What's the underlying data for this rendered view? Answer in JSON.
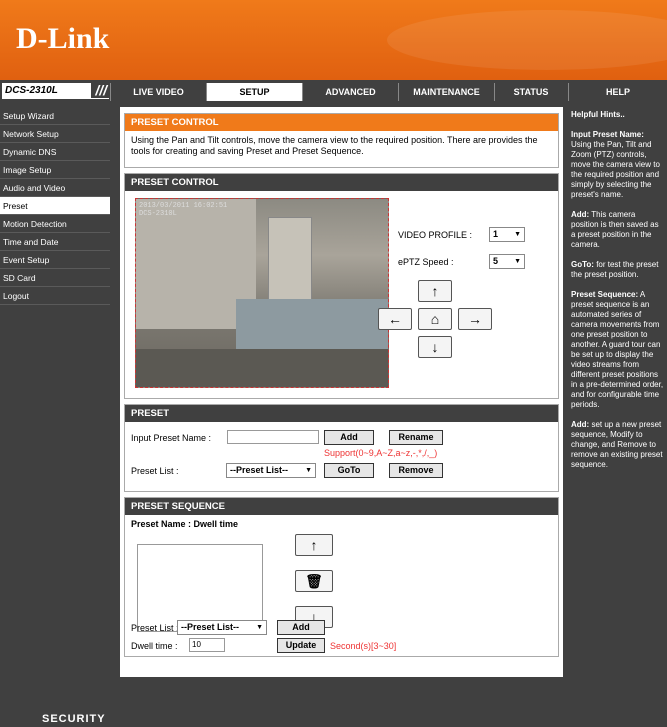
{
  "brand": {
    "logo": "D-Link",
    "model": "DCS-2310L",
    "slash": "///"
  },
  "tabs": [
    "LIVE VIDEO",
    "SETUP",
    "ADVANCED",
    "MAINTENANCE",
    "STATUS",
    "HELP"
  ],
  "sidebar": [
    "Setup Wizard",
    "Network Setup",
    "Dynamic DNS",
    "Image Setup",
    "Audio and Video",
    "Preset",
    "Motion Detection",
    "Time and Date",
    "Event Setup",
    "SD Card",
    "Logout"
  ],
  "intro": {
    "title": "PRESET CONTROL",
    "text": "Using the Pan and Tilt controls, move the camera view to the required position. There are provides the tools for creating and saving Preset and Preset Sequence."
  },
  "control": {
    "title": "PRESET CONTROL",
    "timestamp_line1": "2013/03/2011 16:02:51",
    "timestamp_line2": "DCS-2310L",
    "video_profile_label": "VIDEO PROFILE :",
    "video_profile_value": "1",
    "eptz_label": "ePTZ Speed :",
    "eptz_value": "5",
    "icons": {
      "up": "arrow-up-icon",
      "down": "arrow-down-icon",
      "left": "arrow-left-icon",
      "right": "arrow-right-icon",
      "home": "home-icon"
    }
  },
  "preset": {
    "title": "PRESET",
    "input_label": "Input Preset Name :",
    "input_value": "",
    "add": "Add",
    "rename": "Rename",
    "support": "Support(0~9,A~Z,a~z,-,*,/,_)",
    "list_label": "Preset List :",
    "list_value": "--Preset List--",
    "goto": "GoTo",
    "remove": "Remove"
  },
  "sequence": {
    "title": "PRESET SEQUENCE",
    "header": "Preset Name : Dwell time",
    "list_label": "Preset List :",
    "list_value": "--Preset List--",
    "add": "Add",
    "dwell_label": "Dwell time :",
    "dwell_value": "10",
    "update": "Update",
    "dwell_hint": "Second(s)[3~30]"
  },
  "help": {
    "title": "Helpful Hints..",
    "p1_head": "Input Preset Name:",
    "p1": "Using the Pan, Tilt and Zoom (PTZ) controls, move the camera view to the required position and simply by selecting the preset's name.",
    "p2_head": "Add:",
    "p2": "This camera position is then saved as a preset position in the camera.",
    "p3_head": "GoTo:",
    "p3": "for test the preset the preset position.",
    "p4_head": "Preset Sequence:",
    "p4": "A preset sequence is an automated series of camera movements from one preset position to another. A guard tour can be set up to display the video streams from different preset positions in a pre-determined order, and for configurable time periods.",
    "p5_head": "Add:",
    "p5": "set up a new preset sequence, Modify to change, and Remove to remove an existing preset sequence."
  },
  "footer": {
    "label": "SECURITY"
  }
}
